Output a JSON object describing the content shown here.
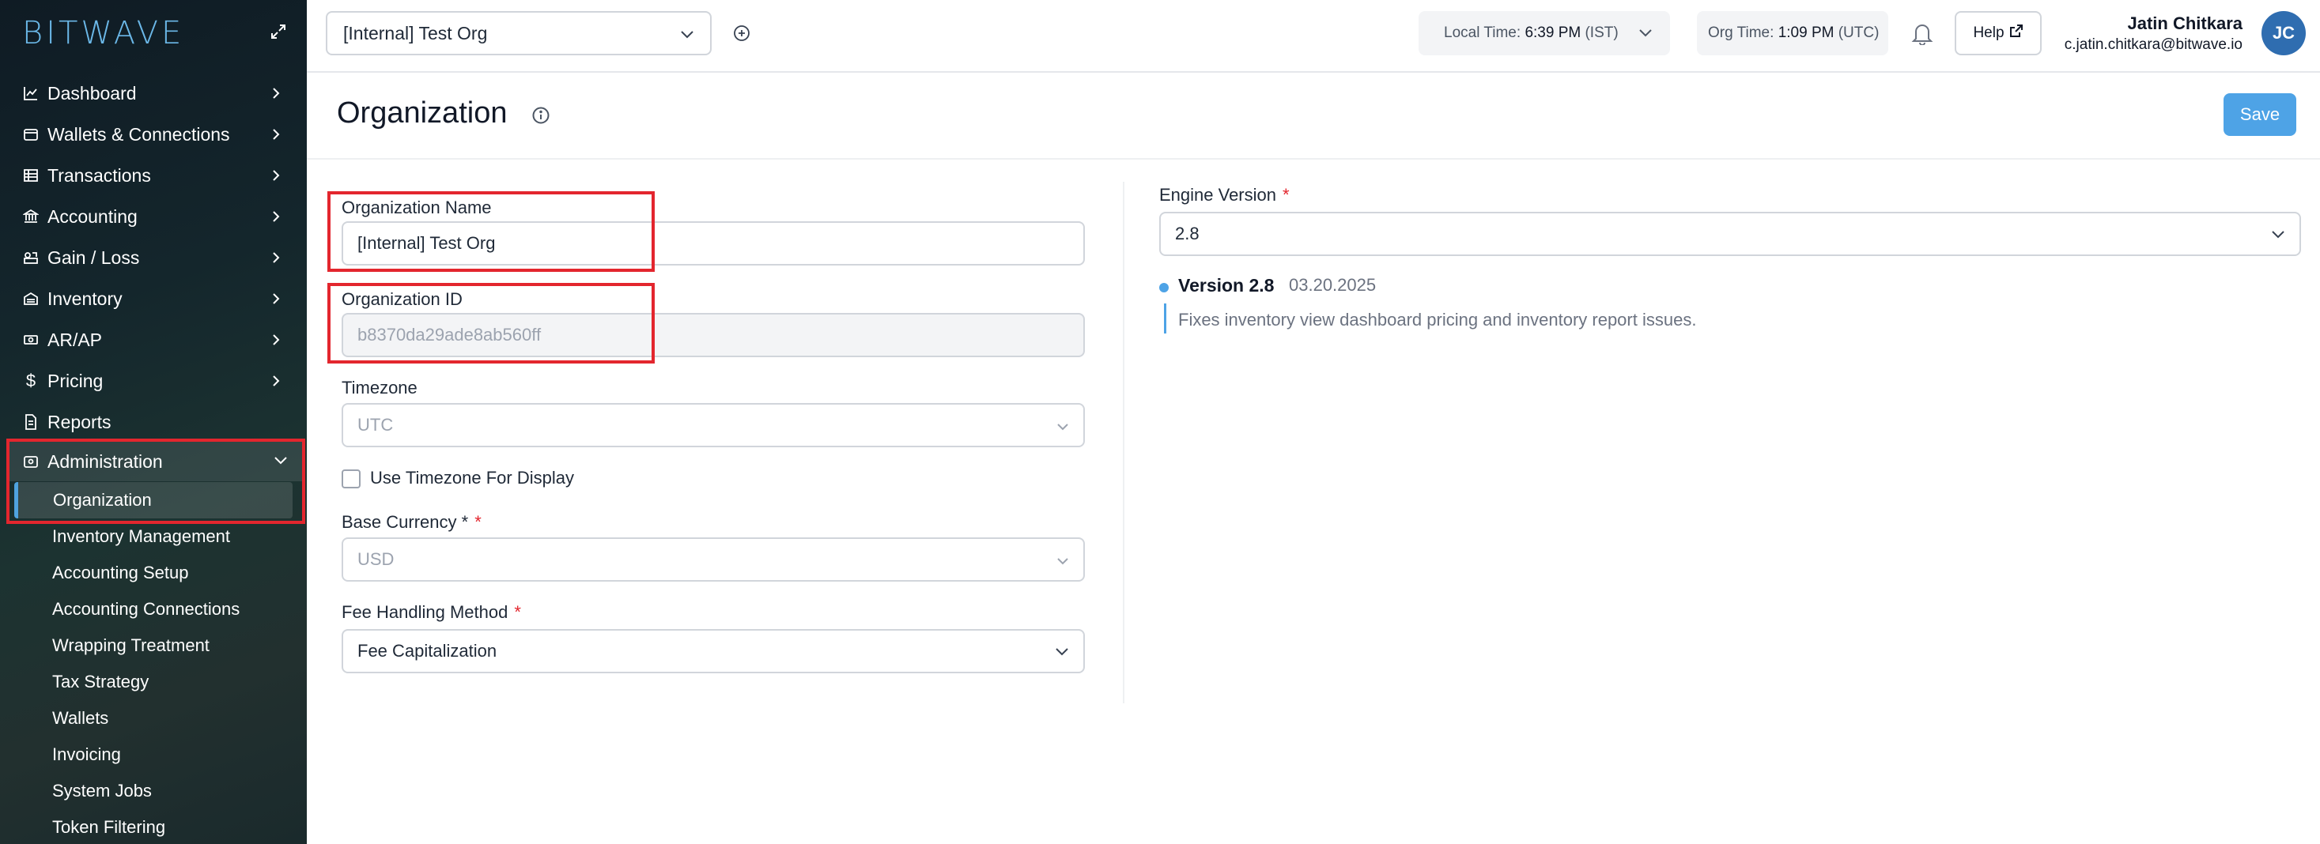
{
  "sidebar": {
    "logo": "BITWAVE",
    "items": [
      {
        "label": "Dashboard",
        "icon": "chart-line-icon"
      },
      {
        "label": "Wallets & Connections",
        "icon": "wallet-icon"
      },
      {
        "label": "Transactions",
        "icon": "table-icon"
      },
      {
        "label": "Accounting",
        "icon": "bank-icon"
      },
      {
        "label": "Gain / Loss",
        "icon": "scale-icon"
      },
      {
        "label": "Inventory",
        "icon": "warehouse-icon"
      },
      {
        "label": "AR/AP",
        "icon": "money-icon"
      },
      {
        "label": "Pricing",
        "icon": "dollar-icon"
      },
      {
        "label": "Reports",
        "icon": "document-icon"
      }
    ],
    "administration": {
      "label": "Administration",
      "active_item": "Organization",
      "sub_items": [
        "Inventory Management",
        "Accounting Setup",
        "Accounting Connections",
        "Wrapping Treatment",
        "Tax Strategy",
        "Wallets",
        "Invoicing",
        "System Jobs",
        "Token Filtering"
      ]
    }
  },
  "topbar": {
    "org_select": "[Internal] Test Org",
    "local_time_label": "Local Time:",
    "local_time_value": "6:39 PM",
    "local_time_zone": "(IST)",
    "org_time_label": "Org Time:",
    "org_time_value": "1:09 PM",
    "org_time_zone": "(UTC)",
    "help_label": "Help",
    "user_name": "Jatin Chitkara",
    "user_email": "c.jatin.chitkara@bitwave.io",
    "avatar_initials": "JC"
  },
  "page": {
    "title": "Organization",
    "save_label": "Save"
  },
  "form": {
    "org_name_label": "Organization Name",
    "org_name_value": "[Internal] Test Org",
    "org_id_label": "Organization ID",
    "org_id_value": "b8370da29ade8ab560ff",
    "timezone_label": "Timezone",
    "timezone_value": "UTC",
    "use_tz_label": "Use Timezone For Display",
    "base_currency_label": "Base Currency *",
    "base_currency_value": "USD",
    "fee_method_label": "Fee Handling Method",
    "fee_method_value": "Fee Capitalization",
    "required_mark": "*"
  },
  "engine": {
    "label": "Engine Version",
    "value": "2.8",
    "version_title": "Version 2.8",
    "version_date": "03.20.2025",
    "version_notes": "Fixes inventory view dashboard pricing and inventory report issues."
  },
  "colors": {
    "accent": "#4ea3e6",
    "highlight": "#e3262e",
    "avatar": "#2f6db0"
  }
}
